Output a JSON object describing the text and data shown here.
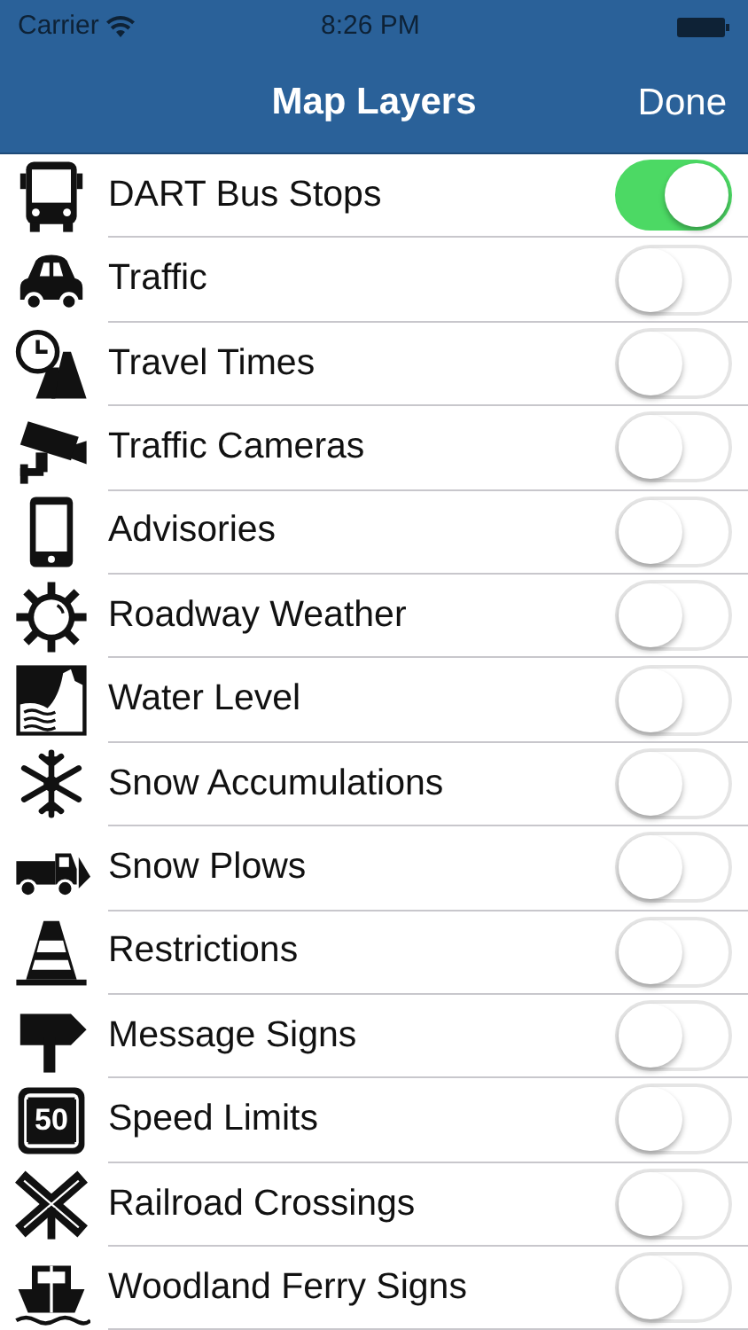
{
  "status_bar": {
    "carrier": "Carrier",
    "time": "8:26 PM"
  },
  "nav_bar": {
    "title": "Map Layers",
    "done": "Done"
  },
  "layers": [
    {
      "label": "DART Bus Stops",
      "on": true
    },
    {
      "label": "Traffic",
      "on": false
    },
    {
      "label": "Travel Times",
      "on": false
    },
    {
      "label": "Traffic Cameras",
      "on": false
    },
    {
      "label": "Advisories",
      "on": false
    },
    {
      "label": "Roadway Weather",
      "on": false
    },
    {
      "label": "Water Level",
      "on": false
    },
    {
      "label": "Snow Accumulations",
      "on": false
    },
    {
      "label": "Snow Plows",
      "on": false
    },
    {
      "label": "Restrictions",
      "on": false
    },
    {
      "label": "Message Signs",
      "on": false
    },
    {
      "label": "Speed Limits",
      "on": false,
      "icon_text": "50"
    },
    {
      "label": "Railroad Crossings",
      "on": false
    },
    {
      "label": "Woodland Ferry Signs",
      "on": false
    }
  ]
}
